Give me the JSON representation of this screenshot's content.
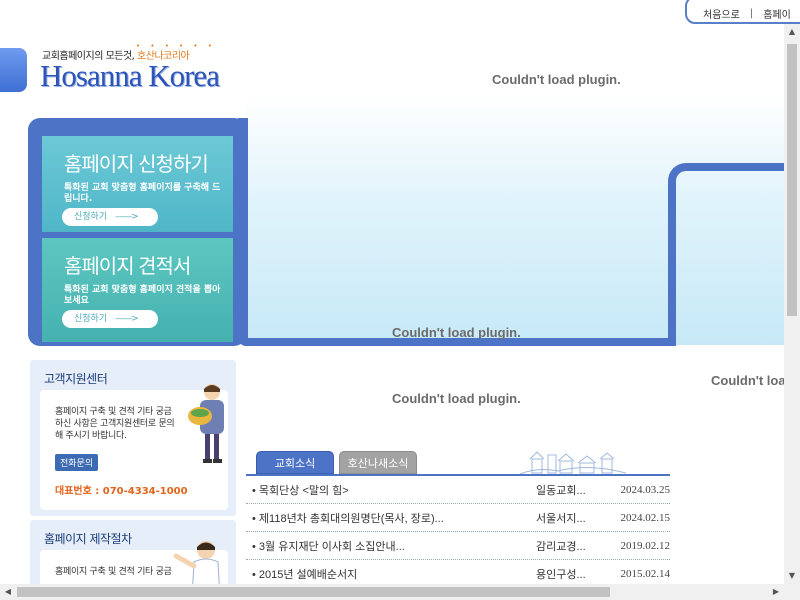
{
  "topnav": {
    "first": "처음으로",
    "separator": "|",
    "home": "홈페이"
  },
  "logo": {
    "tagline_prefix": "교회홈페이지의 모든것,",
    "tagline_accent": "호산나코리아",
    "dots": "• • • • • •",
    "name": "Hosanna Korea"
  },
  "plugin": {
    "message": "Couldn't load plugin."
  },
  "promos": [
    {
      "title": "홈페이지 신청하기",
      "desc": "특화된 교회 맞춤형 홈페이지를 구축해 드립니다.",
      "button": "신청하기",
      "arrow": "——>"
    },
    {
      "title": "홈페이지 견적서",
      "desc": "특화된 교회 맞춤형 홈페이지 견적을 뽑아 보세요",
      "button": "신청하기",
      "arrow": "——>"
    }
  ],
  "support": {
    "title": "고객지원센터",
    "text": "홈페이지 구축 및 견적 기타 궁금하신 사항은 고객지원센터로 문의해 주시기 바랍니다.",
    "call_button": "전화문의",
    "phone": "대표번호 : 070-4334-1000"
  },
  "process": {
    "title": "홈페이지 제작절차",
    "text": "홈페이지 구축 및 견적 기타 궁금"
  },
  "tabs": [
    {
      "label": "교회소식"
    },
    {
      "label": "호산나새소식"
    }
  ],
  "news": [
    {
      "title": "• 목회단상 <말의 힘>",
      "author": "일동교회...",
      "date": "2024.03.25"
    },
    {
      "title": "• 제118년차 총회대의원명단(목사, 장로)...",
      "author": "서울서지...",
      "date": "2024.02.15"
    },
    {
      "title": "• 3월 유지재단 이사회 소집안내...",
      "author": "감리교경...",
      "date": "2019.02.12"
    },
    {
      "title": "• 2015년 설예배순서지",
      "author": "용인구성...",
      "date": "2015.02.14"
    }
  ],
  "colors": {
    "primary": "#4d73c7",
    "accent": "#e07a1d",
    "teal": "#5cc3cf"
  }
}
